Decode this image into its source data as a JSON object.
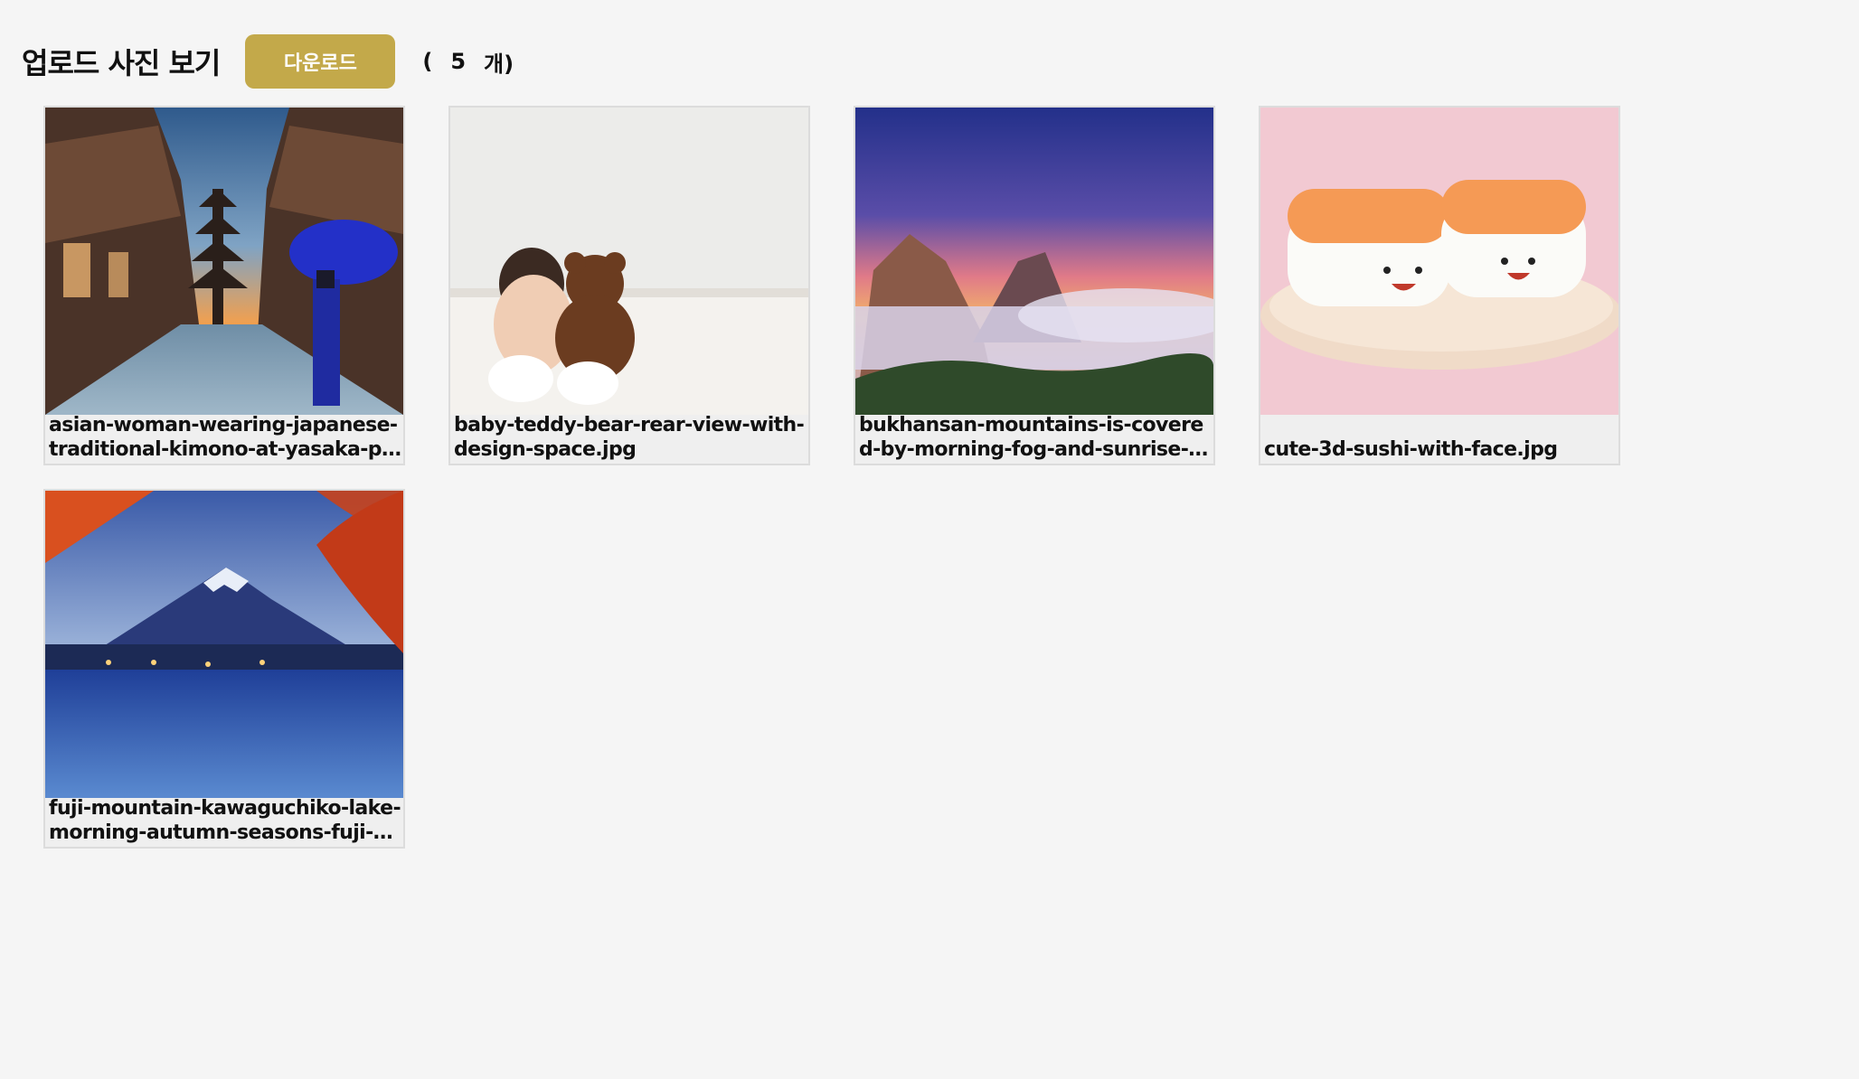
{
  "header": {
    "title": "업로드 사진 보기",
    "download_label": "다운로드",
    "count": {
      "open": "(",
      "value": "5",
      "unit": "개)"
    }
  },
  "colors": {
    "accent": "#c3a94a",
    "background": "#f5f5f5",
    "card": "#efefef"
  },
  "photos": [
    {
      "filename": "asian-woman-wearing-japanese-traditional-kimono-at-yasaka-pagoda.jpg",
      "icon": "kimono-street-photo"
    },
    {
      "filename": "baby-teddy-bear-rear-view-with-design-space.jpg",
      "icon": "baby-teddy-photo"
    },
    {
      "filename": "bukhansan-mountains-is-covered-by-morning-fog-and-sunrise-in-seoul.jpg",
      "icon": "mountain-fog-photo"
    },
    {
      "filename": "cute-3d-sushi-with-face.jpg",
      "icon": "sushi-photo"
    },
    {
      "filename": "fuji-mountain-kawaguchiko-lake-morning-autumn-seasons-fuji-mountain.jpg",
      "icon": "fuji-lake-photo"
    }
  ]
}
